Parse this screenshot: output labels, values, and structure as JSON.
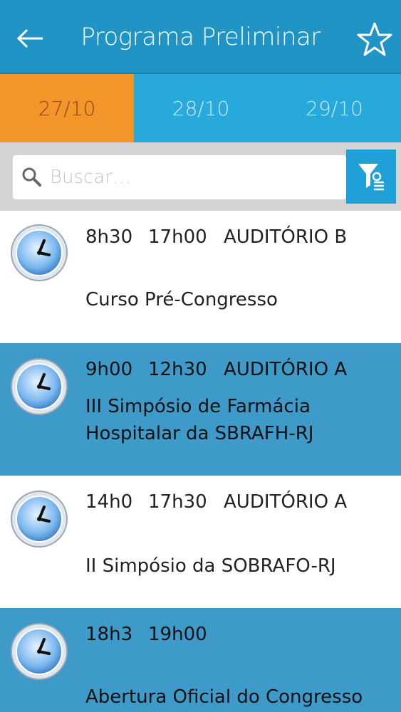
{
  "header": {
    "title": "Programa Preliminar",
    "back_icon": "arrow-left-icon",
    "favorite_icon": "star-icon"
  },
  "tabs": [
    {
      "label": "27/10",
      "active": true
    },
    {
      "label": "28/10",
      "active": false
    },
    {
      "label": "29/10",
      "active": false
    }
  ],
  "search": {
    "placeholder": "Buscar…",
    "value": ""
  },
  "filter": {
    "icon": "filter-icon"
  },
  "colors": {
    "header": "#1f94c5",
    "tab_bar": "#27a9dc",
    "active_tab": "#f4952a",
    "row_highlight": "#3d9ac9"
  },
  "events": [
    {
      "start": "8h30",
      "end": "17h00",
      "room": "AUDITÓRIO B",
      "title": "Curso Pré-Congresso"
    },
    {
      "start": "9h00",
      "end": "12h30",
      "room": "AUDITÓRIO A",
      "title": "III Simpósio de Farmácia Hospitalar da SBRAFH-RJ"
    },
    {
      "start": "14h0",
      "end": "17h30",
      "room": "AUDITÓRIO A",
      "title": "II Simpósio da SOBRAFO-RJ"
    },
    {
      "start": "18h3",
      "end": "19h00",
      "room": "",
      "title": "Abertura Oficial do Congresso"
    }
  ]
}
